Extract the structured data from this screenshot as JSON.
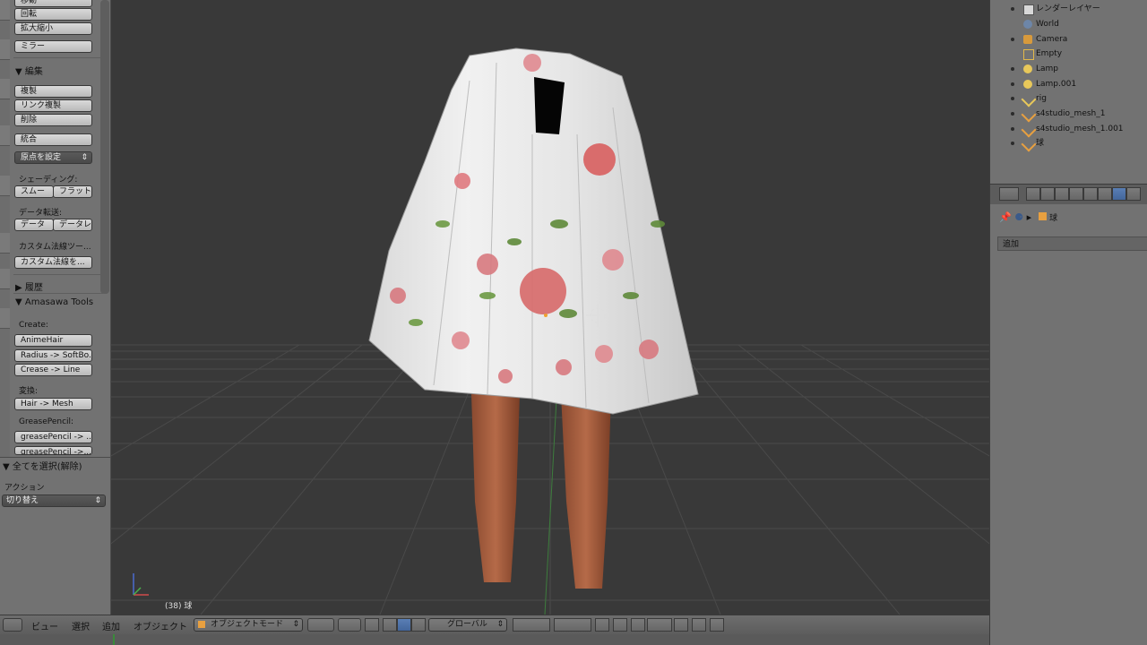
{
  "toolshelf": {
    "transform_buttons": [
      "移動",
      "回転",
      "拡大縮小",
      "ミラー"
    ],
    "edit_header": "編集",
    "edit_buttons": [
      "複製",
      "リンク複製",
      "削除",
      "統合"
    ],
    "origin_select": "原点を設定",
    "shading_label": "シェーディング:",
    "shading_buttons": [
      "スムー",
      "フラット"
    ],
    "data_transfer_label": "データ転送:",
    "data_transfer_buttons": [
      "データ",
      "データレ"
    ],
    "custom_normal_tools": "カスタム法線ツー...",
    "custom_normal_btn": "カスタム法線を...",
    "history_header": "履歴",
    "amasawa_header": "Amasawa Tools",
    "create_label": "Create:",
    "create_buttons": [
      "AnimeHair",
      "Radius -> SoftBo...",
      "Crease -> Line"
    ],
    "convert_label": "変換:",
    "convert_buttons": [
      "Hair -> Mesh"
    ],
    "grease_label": "GreasePencil:",
    "grease_buttons": [
      "greasePencil -> ...",
      "greasePencil ->..."
    ]
  },
  "operator_panel": {
    "title": "全てを選択(解除)",
    "action_label": "アクション",
    "action_value": "切り替え"
  },
  "viewport": {
    "frame_label": "(38) 球"
  },
  "outliner": {
    "items": [
      {
        "label": "レンダーレイヤー",
        "icon": "render-layers-icon",
        "color": "#d8d8d8"
      },
      {
        "label": "World",
        "icon": "world-icon",
        "color": "#6d86a8"
      },
      {
        "label": "Camera",
        "icon": "camera-icon",
        "color": "#d89a3c"
      },
      {
        "label": "Empty",
        "icon": "empty-icon",
        "color": "#e2b84a"
      },
      {
        "label": "Lamp",
        "icon": "lamp-icon",
        "color": "#e8c85a"
      },
      {
        "label": "Lamp.001",
        "icon": "lamp-icon",
        "color": "#e8c85a"
      },
      {
        "label": "rig",
        "icon": "armature-icon",
        "color": "#e8c85a"
      },
      {
        "label": "s4studio_mesh_1",
        "icon": "mesh-icon",
        "color": "#e8a040"
      },
      {
        "label": "s4studio_mesh_1.001",
        "icon": "mesh-icon",
        "color": "#e8a040"
      },
      {
        "label": "球",
        "icon": "mesh-icon",
        "color": "#e8a040"
      }
    ]
  },
  "properties": {
    "breadcrumb_object": "球",
    "add_panel_label": "追加"
  },
  "header": {
    "menus": [
      "ビュー",
      "選択",
      "追加",
      "オブジェクト"
    ],
    "mode": "オブジェクトモード",
    "orientation": "グローバル"
  },
  "colors": {
    "viewport_bg": "#393939",
    "panel_bg": "#727272",
    "active_blue": "#5a7fb5"
  }
}
